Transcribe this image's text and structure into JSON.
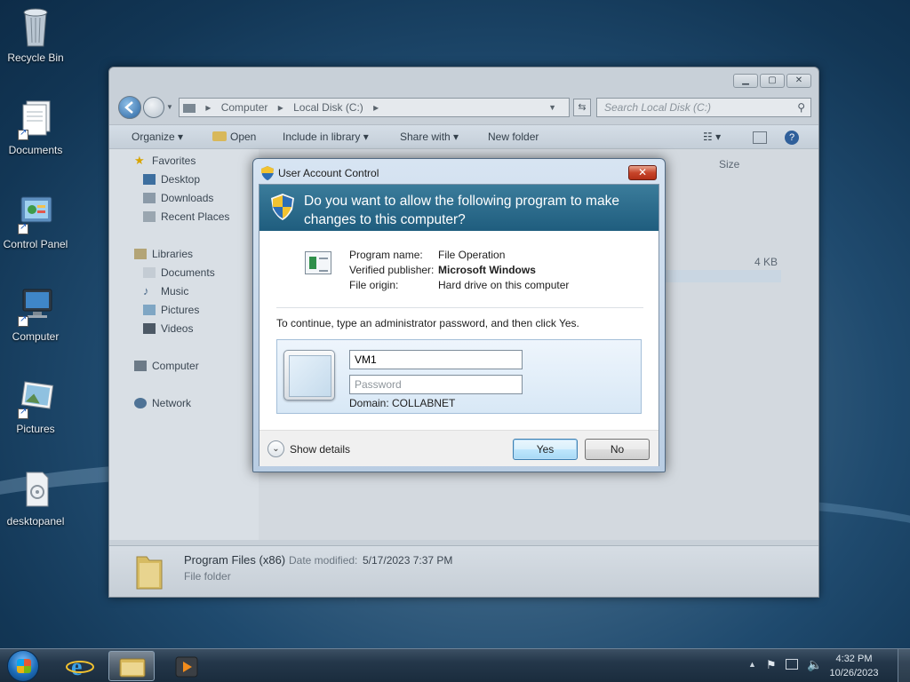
{
  "desktop": {
    "icons": [
      {
        "label": "Recycle Bin",
        "icon": "recycle-bin-icon"
      },
      {
        "label": "Documents",
        "icon": "documents-shortcut-icon"
      },
      {
        "label": "Control Panel",
        "icon": "control-panel-shortcut-icon"
      },
      {
        "label": "Computer",
        "icon": "computer-shortcut-icon"
      },
      {
        "label": "Pictures",
        "icon": "pictures-shortcut-icon"
      },
      {
        "label": "desktopanel",
        "icon": "desktopanel-icon"
      }
    ]
  },
  "explorer": {
    "address": [
      "Computer",
      "Local Disk (C:)"
    ],
    "search_placeholder": "Search Local Disk (C:)",
    "toolbar": {
      "organize": "Organize",
      "open": "Open",
      "include_in_library": "Include in library",
      "share_with": "Share with",
      "new_folder": "New folder"
    },
    "column_size": "Size",
    "size_value": "4 KB",
    "nav": {
      "favorites": "Favorites",
      "desktop": "Desktop",
      "downloads": "Downloads",
      "recent_places": "Recent Places",
      "libraries": "Libraries",
      "documents": "Documents",
      "music": "Music",
      "pictures": "Pictures",
      "videos": "Videos",
      "computer": "Computer",
      "network": "Network"
    },
    "details": {
      "name": "Program Files (x86)",
      "date_label": "Date modified:",
      "date_value": "5/17/2023 7:37 PM",
      "type": "File folder"
    }
  },
  "uac": {
    "title": "User Account Control",
    "question": "Do you want to allow the following program to make changes to this computer?",
    "program_name_label": "Program name:",
    "program_name": "File Operation",
    "publisher_label": "Verified publisher:",
    "publisher": "Microsoft Windows",
    "origin_label": "File origin:",
    "origin": "Hard drive on this computer",
    "instruction": "To continue, type an administrator password, and then click Yes.",
    "username_value": "VM1",
    "password_placeholder": "Password",
    "domain": "Domain: COLLABNET",
    "show_details": "Show details",
    "yes": "Yes",
    "no": "No",
    "colors": {
      "banner": "#2a6d8f",
      "close": "#c7452a"
    }
  },
  "taskbar": {
    "time": "4:32 PM",
    "date": "10/26/2023"
  }
}
